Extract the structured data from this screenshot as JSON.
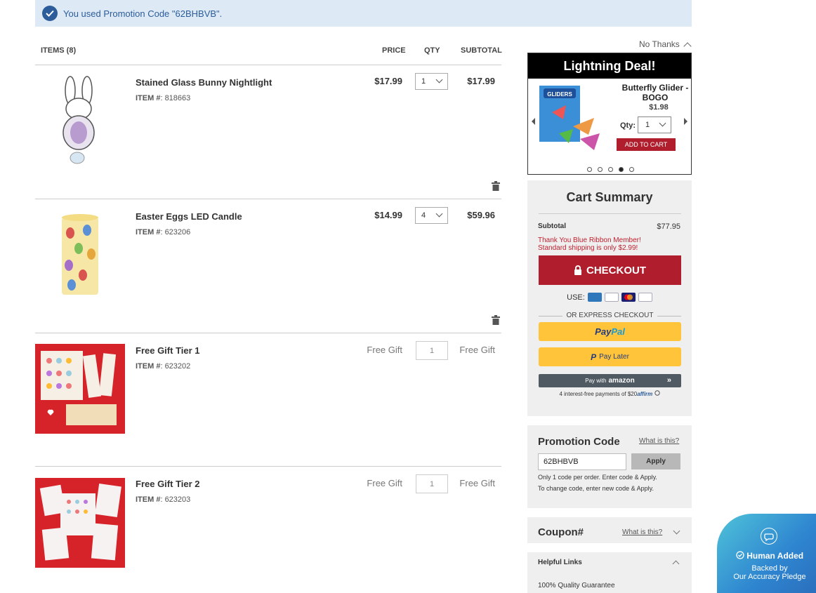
{
  "promo_banner": {
    "text": "You used Promotion Code \"62BHBVB\"."
  },
  "cart_header": {
    "items": "ITEMS (8)",
    "price": "PRICE",
    "qty": "QTY",
    "subtotal": "SUBTOTAL"
  },
  "items": [
    {
      "name": "Stained Glass Bunny Nightlight",
      "item_label": "ITEM #",
      "item_number": ": 818663",
      "price": "$17.99",
      "qty": "1",
      "subtotal": "$17.99"
    },
    {
      "name": "Easter Eggs LED Candle",
      "item_label": "ITEM #",
      "item_number": ": 623206",
      "price": "$14.99",
      "qty": "4",
      "subtotal": "$59.96"
    },
    {
      "name": "Free Gift Tier 1",
      "item_label": "ITEM #",
      "item_number": ": 623202",
      "price": "Free Gift",
      "qty": "1",
      "subtotal": "Free Gift"
    },
    {
      "name": "Free Gift Tier 2",
      "item_label": "ITEM #",
      "item_number": ": 623203",
      "price": "Free Gift",
      "qty": "1",
      "subtotal": "Free Gift"
    }
  ],
  "deal": {
    "no_thanks": "No Thanks",
    "title": "Lightning Deal!",
    "product_name": "Butterfly Glider - BOGO",
    "price": "$1.98",
    "qty_label": "Qty:",
    "qty": "1",
    "add_button": "ADD TO CART",
    "image_text": "GLIDERS",
    "slide_count": 5,
    "active_slide": 4
  },
  "summary": {
    "title": "Cart Summary",
    "subtotal_label": "Subtotal",
    "subtotal_value": "$77.95",
    "ribbon_line1": "Thank You Blue Ribbon Member!",
    "ribbon_line2": "Standard shipping is only $2.99!",
    "checkout_label": "CHECKOUT",
    "use_label": "USE:",
    "cards": [
      "AMEX",
      "VISA",
      "MC",
      "DISC"
    ],
    "or_express": "OR EXPRESS CHECKOUT",
    "paypal_part1": "Pay",
    "paypal_part2": "Pal",
    "pay_later_icon": "P",
    "pay_later": "Pay Later",
    "amazon_pre": "Pay with",
    "amazon_brand": "amazon",
    "amazon_chevron": "»",
    "affirm_text": "4 interest-free payments of $20",
    "affirm_brand": "affirm"
  },
  "promo": {
    "title": "Promotion Code",
    "what_link": "What is this?",
    "input_value": "62BHBVB",
    "apply_label": "Apply",
    "note1": "Only 1 code per order. Enter code & Apply.",
    "note2": "To change code, enter new code & Apply."
  },
  "coupon": {
    "title": "Coupon#",
    "what_link": "What is this?"
  },
  "helpful": {
    "title": "Helpful Links",
    "item1": "100% Quality Guarantee"
  },
  "badge": {
    "line1": "Human Added",
    "line2": "Backed by",
    "line3": "Our Accuracy Pledge"
  },
  "colors": {
    "brand_red": "#b01e2d",
    "banner_bg": "#dde9f5",
    "banner_text": "#2c5d9a",
    "paypal_yellow": "#ffc439"
  }
}
